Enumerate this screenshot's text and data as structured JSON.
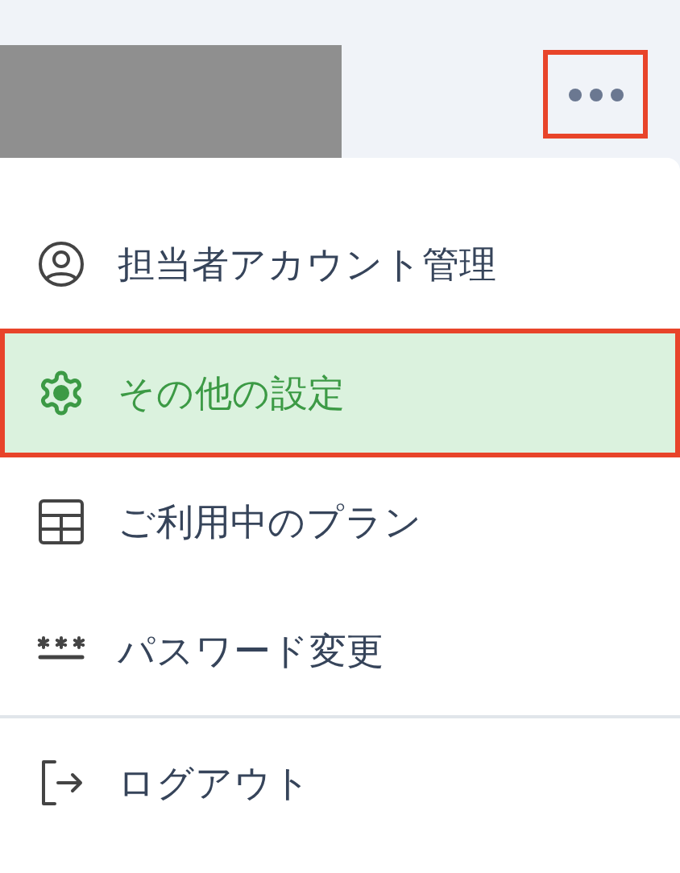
{
  "header": {
    "more_button": {
      "highlighted": true
    }
  },
  "menu": {
    "groups": [
      {
        "items": [
          {
            "kind": "account",
            "label": "担当者アカウント管理",
            "selected": false
          },
          {
            "kind": "settings",
            "label": "その他の設定",
            "selected": true
          },
          {
            "kind": "plan",
            "label": "ご利用中のプラン",
            "selected": false
          },
          {
            "kind": "password",
            "label": "パスワード変更",
            "selected": false
          }
        ]
      },
      {
        "items": [
          {
            "kind": "logout",
            "label": "ログアウト",
            "selected": false
          }
        ]
      }
    ]
  }
}
